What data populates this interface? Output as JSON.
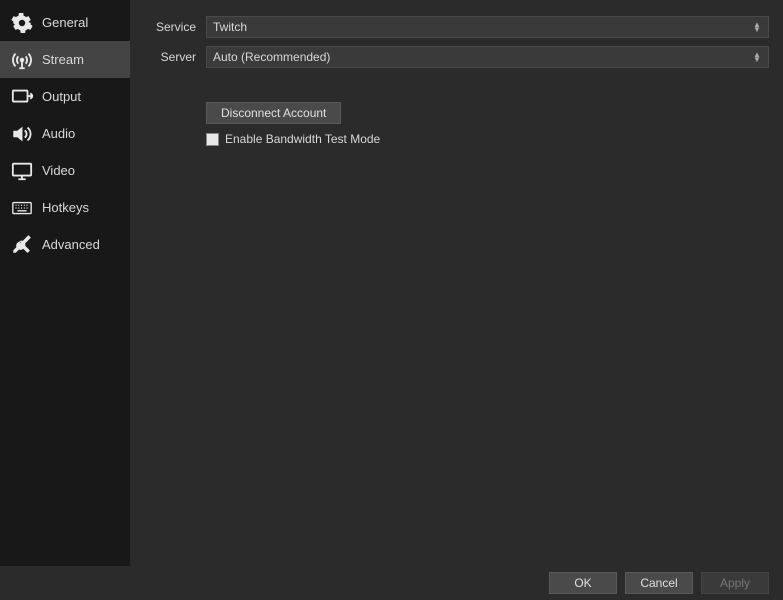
{
  "sidebar": {
    "items": [
      {
        "label": "General",
        "icon": "gear",
        "selected": false
      },
      {
        "label": "Stream",
        "icon": "antenna",
        "selected": true
      },
      {
        "label": "Output",
        "icon": "output",
        "selected": false
      },
      {
        "label": "Audio",
        "icon": "speaker",
        "selected": false
      },
      {
        "label": "Video",
        "icon": "monitor",
        "selected": false
      },
      {
        "label": "Hotkeys",
        "icon": "keyboard",
        "selected": false
      },
      {
        "label": "Advanced",
        "icon": "tools",
        "selected": false
      }
    ]
  },
  "form": {
    "service_label": "Service",
    "service_value": "Twitch",
    "server_label": "Server",
    "server_value": "Auto (Recommended)",
    "disconnect_label": "Disconnect Account",
    "bandwidth_label": "Enable Bandwidth Test Mode",
    "bandwidth_checked": false
  },
  "footer": {
    "ok": "OK",
    "cancel": "Cancel",
    "apply": "Apply"
  }
}
